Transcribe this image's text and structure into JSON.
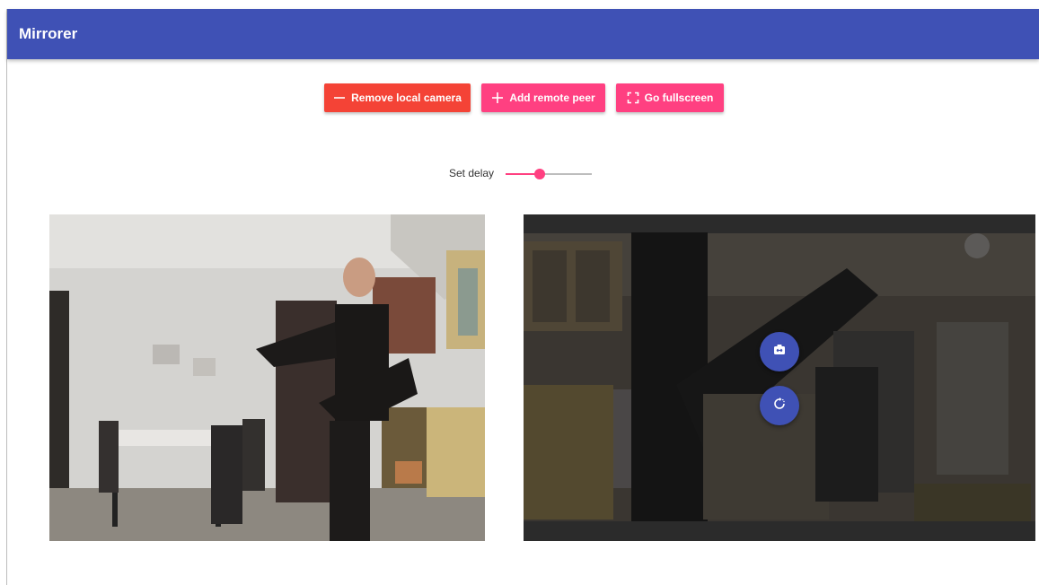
{
  "app": {
    "title": "Mirrorer"
  },
  "toolbar": {
    "remove_local_camera": {
      "label": "Remove local camera",
      "icon": "minus-icon",
      "color": "#f44336"
    },
    "add_remote_peer": {
      "label": "Add remote peer",
      "icon": "plus-icon",
      "color": "#ff4081"
    },
    "go_fullscreen": {
      "label": "Go fullscreen",
      "icon": "fullscreen-icon",
      "color": "#ff4081"
    }
  },
  "delay": {
    "label": "Set delay",
    "value_fraction": 0.4
  },
  "colors": {
    "primary": "#3f51b5",
    "accent": "#ff4081",
    "danger": "#f44336"
  },
  "videos": {
    "local": {
      "name": "local-camera-video"
    },
    "remote": {
      "name": "remote-peer-video",
      "controls": [
        {
          "name": "swap-camera-button",
          "icon": "switch-camera-icon"
        },
        {
          "name": "rotate-video-button",
          "icon": "rotate-icon"
        }
      ]
    }
  }
}
